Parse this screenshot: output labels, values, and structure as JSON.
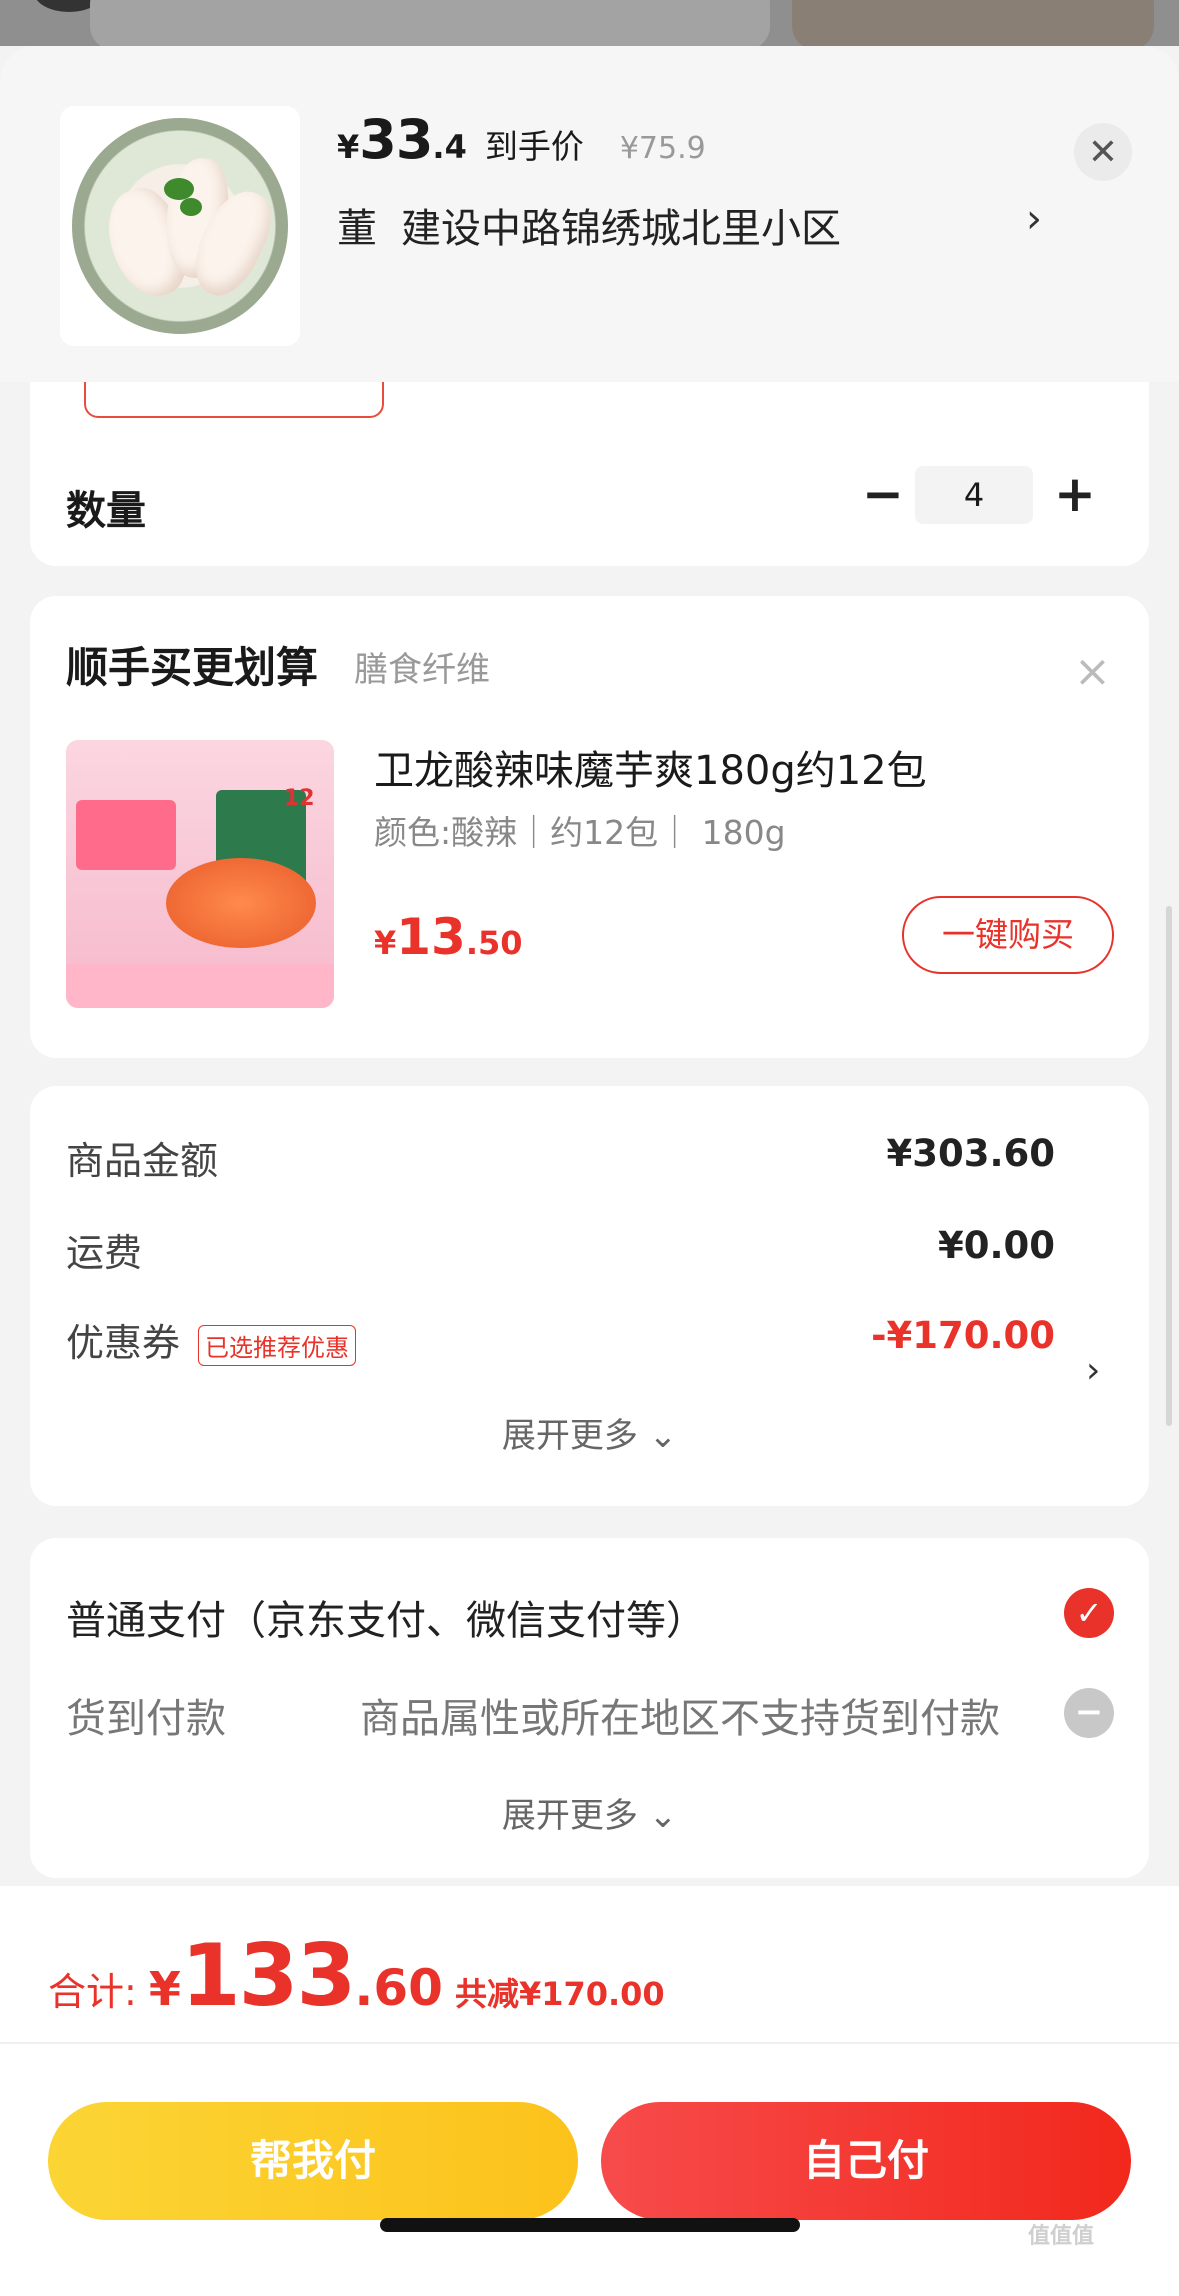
{
  "header": {
    "currency": "¥",
    "price_int": "33",
    "price_dec": ".4",
    "price_label": "到手价",
    "original_price": "¥75.9",
    "recipient": "董",
    "address": "建设中路锦绣城北里小区",
    "chevron": "›",
    "close": "✕"
  },
  "quantity": {
    "label": "数量",
    "value": "4",
    "minus": "−",
    "plus": "+"
  },
  "upsell": {
    "title": "顺手买更划算",
    "subtitle": "膳食纤维",
    "close": "×",
    "product": {
      "name": "卫龙酸辣味魔芋爽180g约12包",
      "spec": "颜色:酸辣｜约12包｜ 180g",
      "currency": "¥",
      "price_int": "13",
      "price_dec": ".50",
      "buy_label": "一键购买",
      "image_num": "12"
    }
  },
  "summary": {
    "goods_label": "商品金额",
    "goods_value": "¥303.60",
    "shipping_label": "运费",
    "shipping_value": "¥0.00",
    "coupon_label": "优惠券",
    "coupon_tag": "已选推荐优惠",
    "coupon_value": "-¥170.00",
    "coupon_chevron": "›",
    "expand_label": "展开更多 ⌄"
  },
  "payment": {
    "normal_label": "普通支付（京东支付、微信支付等）",
    "check": "✓",
    "cod_label": "货到付款",
    "cod_note": "商品属性或所在地区不支持货到付款",
    "cod_icon": "−",
    "expand_label": "展开更多 ⌄"
  },
  "footer": {
    "total_label": "合计:",
    "currency": "¥",
    "total_int": "133",
    "total_dec": ".60",
    "savings": "共减¥170.00",
    "help_pay": "帮我付",
    "self_pay": "自己付"
  },
  "watermark": "值值值",
  "colors": {
    "accent": "#e8322a",
    "help_button": "#fcc21b",
    "self_button": "#f2281c"
  }
}
